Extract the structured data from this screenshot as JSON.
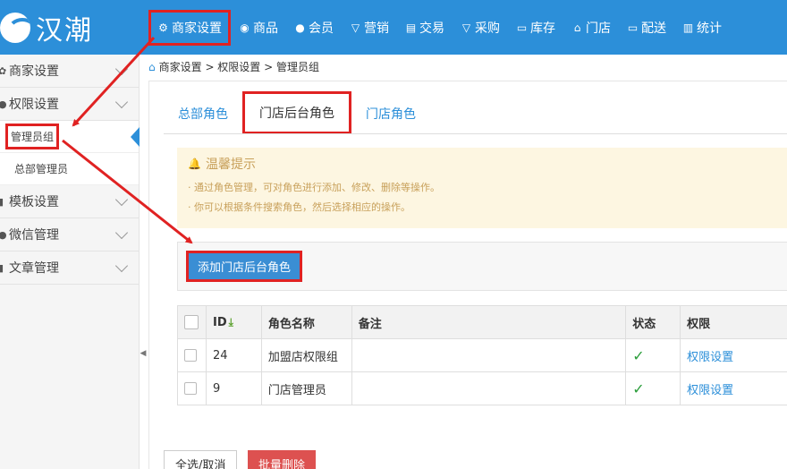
{
  "app": {
    "logo_text": "汉潮"
  },
  "nav": [
    {
      "label": "商家设置",
      "icon": "⚙",
      "icon_name": "gear-icon",
      "active": true
    },
    {
      "label": "商品",
      "icon": "◉",
      "icon_name": "cube-icon"
    },
    {
      "label": "会员",
      "icon": "●",
      "icon_name": "user-icon"
    },
    {
      "label": "营销",
      "icon": "▽",
      "icon_name": "trophy-icon"
    },
    {
      "label": "交易",
      "icon": "▤",
      "icon_name": "receipt-icon"
    },
    {
      "label": "采购",
      "icon": "▽",
      "icon_name": "cart-icon"
    },
    {
      "label": "库存",
      "icon": "▭",
      "icon_name": "warehouse-icon"
    },
    {
      "label": "门店",
      "icon": "⌂",
      "icon_name": "store-icon"
    },
    {
      "label": "配送",
      "icon": "▭",
      "icon_name": "truck-icon"
    },
    {
      "label": "统计",
      "icon": "▥",
      "icon_name": "bar-chart-icon"
    }
  ],
  "sidebar": {
    "groups": [
      {
        "label": "商家设置",
        "icon": "✿",
        "icon_name": "gear-icon"
      },
      {
        "label": "权限设置",
        "icon": "●",
        "icon_name": "lock-icon",
        "items": [
          {
            "label": "管理员组",
            "active": true
          },
          {
            "label": "总部管理员"
          }
        ]
      },
      {
        "label": "模板设置",
        "icon": "▮",
        "icon_name": "template-icon"
      },
      {
        "label": "微信管理",
        "icon": "●",
        "icon_name": "wechat-icon"
      },
      {
        "label": "文章管理",
        "icon": "▮",
        "icon_name": "article-icon"
      }
    ]
  },
  "breadcrumb": {
    "path": "商家设置 > 权限设置 > 管理员组"
  },
  "tabs": [
    {
      "label": "总部角色"
    },
    {
      "label": "门店后台角色",
      "active": true
    },
    {
      "label": "门店角色"
    }
  ],
  "tip": {
    "title": "温馨提示",
    "lines": [
      "· 通过角色管理，可对角色进行添加、修改、删除等操作。",
      "· 你可以根据条件搜索角色，然后选择相应的操作。"
    ]
  },
  "toolbar": {
    "add_label": "添加门店后台角色"
  },
  "table": {
    "headers": {
      "id": "ID",
      "name": "角色名称",
      "remark": "备注",
      "status": "状态",
      "perm": "权限"
    },
    "rows": [
      {
        "id": "24",
        "name": "加盟店权限组",
        "remark": "",
        "status": "✓",
        "perm": "权限设置"
      },
      {
        "id": "9",
        "name": "门店管理员",
        "remark": "",
        "status": "✓",
        "perm": "权限设置"
      }
    ]
  },
  "footer": {
    "select_label": "全选/取消",
    "delete_label": "批量删除"
  },
  "colors": {
    "primary": "#2c8fd9",
    "highlight": "#e02222",
    "danger": "#dd5150",
    "success": "#2a9d3a"
  }
}
